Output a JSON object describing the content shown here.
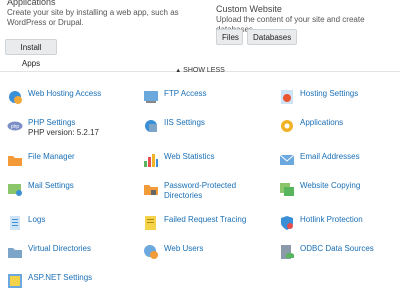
{
  "top": {
    "applications": {
      "title": "Applications",
      "desc_line1": "Create your site by installing a web app, such as",
      "desc_line2": "WordPress or Drupal.",
      "install_label": "Install Apps"
    },
    "custom": {
      "title": "Custom Website",
      "desc": "Upload the content of your site and create databases.",
      "files_label": "Files",
      "databases_label": "Databases"
    }
  },
  "show_less": "SHOW LESS",
  "items": [
    {
      "label": "Web Hosting Access",
      "icon": "web-hosting-access-icon"
    },
    {
      "label": "FTP Access",
      "icon": "ftp-access-icon"
    },
    {
      "label": "Hosting Settings",
      "icon": "hosting-settings-icon"
    },
    {
      "label": "PHP Settings",
      "sub": "PHP version: 5.2.17",
      "icon": "php-icon"
    },
    {
      "label": "IIS Settings",
      "icon": "iis-settings-icon"
    },
    {
      "label": "Applications",
      "icon": "applications-gear-icon"
    },
    {
      "label": "File Manager",
      "icon": "folder-icon"
    },
    {
      "label": "Web Statistics",
      "icon": "bar-chart-icon"
    },
    {
      "label": "Email Addresses",
      "icon": "envelope-icon"
    },
    {
      "label": "Mail Settings",
      "icon": "mail-settings-icon"
    },
    {
      "label": "Password-Protected",
      "label2": "Directories",
      "icon": "locked-folder-icon"
    },
    {
      "label": "Website Copying",
      "icon": "website-copy-icon"
    },
    {
      "label": "Logs",
      "icon": "logs-icon"
    },
    {
      "label": "Failed Request Tracing",
      "icon": "tracing-icon"
    },
    {
      "label": "Hotlink Protection",
      "icon": "hotlink-shield-icon"
    },
    {
      "label": "Virtual Directories",
      "icon": "virtual-directory-icon"
    },
    {
      "label": "Web Users",
      "icon": "web-users-icon"
    },
    {
      "label": "ODBC Data Sources",
      "icon": "odbc-icon"
    },
    {
      "label": "ASP.NET Settings",
      "icon": "aspnet-icon"
    }
  ]
}
